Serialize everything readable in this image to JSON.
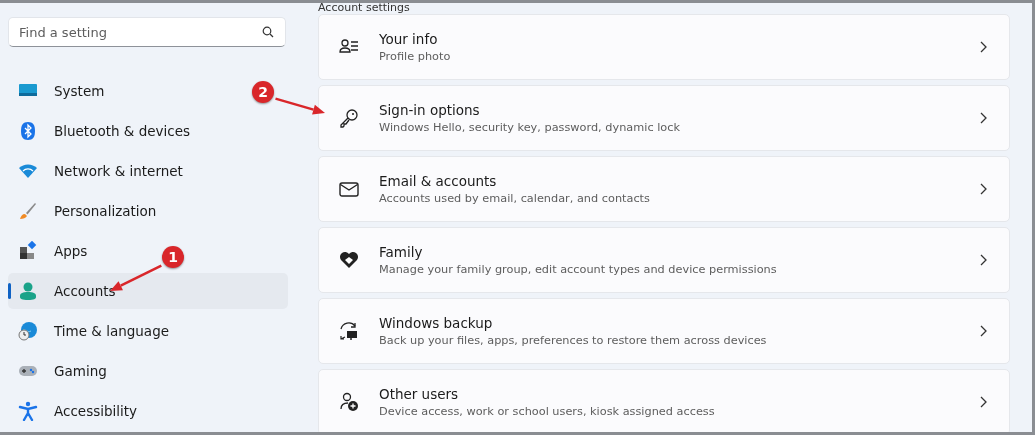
{
  "search": {
    "placeholder": "Find a setting"
  },
  "nav": [
    {
      "label": "System",
      "kind": "system",
      "selected": false
    },
    {
      "label": "Bluetooth & devices",
      "kind": "bluetooth",
      "selected": false
    },
    {
      "label": "Network & internet",
      "kind": "wifi",
      "selected": false
    },
    {
      "label": "Personalization",
      "kind": "brush",
      "selected": false
    },
    {
      "label": "Apps",
      "kind": "apps",
      "selected": false
    },
    {
      "label": "Accounts",
      "kind": "person",
      "selected": true
    },
    {
      "label": "Time & language",
      "kind": "globe",
      "selected": false
    },
    {
      "label": "Gaming",
      "kind": "gamepad",
      "selected": false
    },
    {
      "label": "Accessibility",
      "kind": "accessibility",
      "selected": false
    }
  ],
  "section_title": "Account settings",
  "cards": [
    {
      "title": "Your info",
      "subtitle": "Profile photo",
      "kind": "info"
    },
    {
      "title": "Sign-in options",
      "subtitle": "Windows Hello, security key, password, dynamic lock",
      "kind": "key"
    },
    {
      "title": "Email & accounts",
      "subtitle": "Accounts used by email, calendar, and contacts",
      "kind": "mail"
    },
    {
      "title": "Family",
      "subtitle": "Manage your family group, edit account types and device permissions",
      "kind": "family"
    },
    {
      "title": "Windows backup",
      "subtitle": "Back up your files, apps, preferences to restore them across devices",
      "kind": "backup"
    },
    {
      "title": "Other users",
      "subtitle": "Device access, work or school users, kiosk assigned access",
      "kind": "adduser"
    }
  ],
  "annotations": [
    {
      "number": "1"
    },
    {
      "number": "2"
    }
  ]
}
